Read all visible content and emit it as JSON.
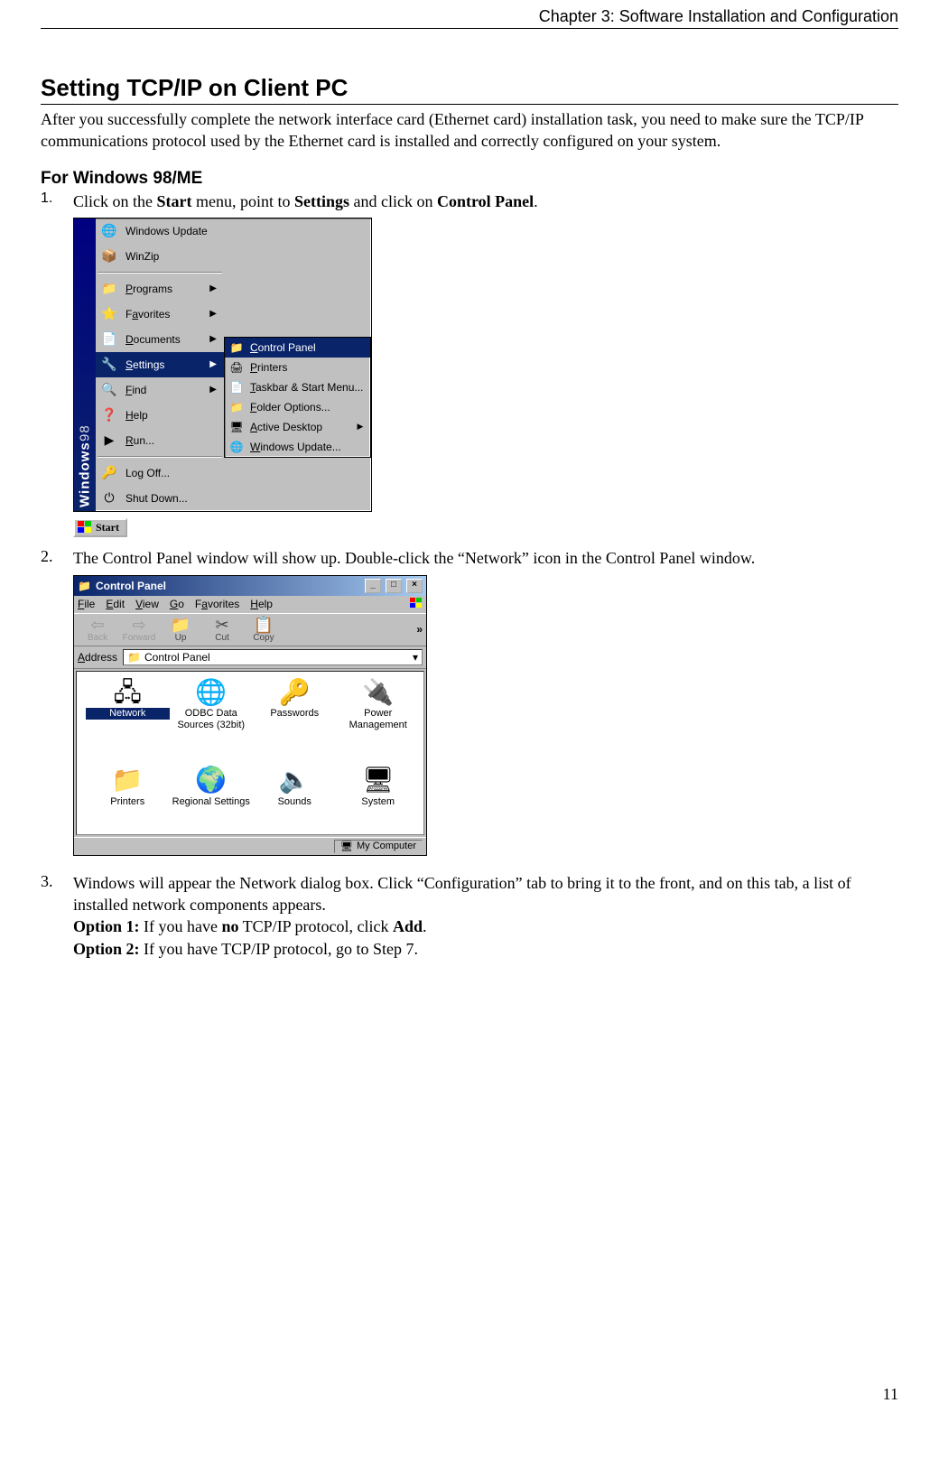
{
  "chapter_header": "Chapter 3: Software Installation and Configuration",
  "section_title": "Setting TCP/IP on Client PC",
  "intro_text": "After you successfully complete the network interface card (Ethernet card) installation task, you need to make sure the TCP/IP communications protocol used by the Ethernet card is installed and correctly configured on your system.",
  "sub_title": "For Windows 98/ME",
  "steps": {
    "s1": {
      "num": "1.",
      "pre": "Click on the ",
      "b1": "Start",
      "mid1": " menu, point to ",
      "b2": "Settings",
      "mid2": " and click on ",
      "b3": "Control Panel",
      "post": "."
    },
    "s2": {
      "num": "2.",
      "text": "The Control Panel window will show up. Double-click the “Network” icon in the Control Panel window."
    },
    "s3": {
      "num": "3.",
      "line1": "Windows will appear the Network dialog box. Click “Configuration” tab to bring it to the front, and on this tab, a list of installed network components appears.",
      "opt1_label": "Option 1:",
      "opt1_a": " If you have ",
      "opt1_b": "no",
      "opt1_c": " TCP/IP protocol, click ",
      "opt1_d": "Add",
      "opt1_e": ".",
      "opt2_label": "Option 2:",
      "opt2_text": " If you have TCP/IP protocol, go to Step 7."
    }
  },
  "start_menu": {
    "strip_a": "Windows",
    "strip_b": "98",
    "items": [
      {
        "label": "Windows Update",
        "icon": "🌐"
      },
      {
        "label": "WinZip",
        "icon": "📦"
      },
      {
        "label": "Programs",
        "icon": "📁",
        "arrow": true,
        "ukey": "P"
      },
      {
        "label": "Favorites",
        "icon": "⭐",
        "arrow": true,
        "ukey": "a"
      },
      {
        "label": "Documents",
        "icon": "📄",
        "arrow": true,
        "ukey": "D"
      },
      {
        "label": "Settings",
        "icon": "🔧",
        "arrow": true,
        "hl": true,
        "ukey": "S"
      },
      {
        "label": "Find",
        "icon": "🔍",
        "arrow": true,
        "ukey": "F"
      },
      {
        "label": "Help",
        "icon": "❓",
        "ukey": "H"
      },
      {
        "label": "Run...",
        "icon": "▶",
        "ukey": "R"
      },
      {
        "label": "Log Off...",
        "icon": "🔑"
      },
      {
        "label": "Shut Down...",
        "icon": "⏻"
      }
    ],
    "submenu": [
      {
        "label": "Control Panel",
        "icon": "📁",
        "hl": true,
        "ukey": "C"
      },
      {
        "label": "Printers",
        "icon": "🖨",
        "ukey": "P"
      },
      {
        "label": "Taskbar & Start Menu...",
        "icon": "📄",
        "ukey": "T"
      },
      {
        "label": "Folder Options...",
        "icon": "📁",
        "ukey": "F"
      },
      {
        "label": "Active Desktop",
        "icon": "🖥",
        "arrow": true,
        "ukey": "A"
      },
      {
        "label": "Windows Update...",
        "icon": "🌐",
        "ukey": "W"
      }
    ],
    "start_button": "Start"
  },
  "control_panel": {
    "title": "Control Panel",
    "menus": [
      {
        "label": "File",
        "u": "F"
      },
      {
        "label": "Edit",
        "u": "E"
      },
      {
        "label": "View",
        "u": "V"
      },
      {
        "label": "Go",
        "u": "G"
      },
      {
        "label": "Favorites",
        "u": "a"
      },
      {
        "label": "Help",
        "u": "H"
      }
    ],
    "toolbar": {
      "back": "Back",
      "forward": "Forward",
      "up": "Up",
      "cut": "Cut",
      "copy": "Copy"
    },
    "address_label": "Address",
    "address_value": "Control Panel",
    "icons": [
      {
        "label": "Network",
        "glyph": "🖧",
        "sel": true
      },
      {
        "label": "ODBC Data Sources (32bit)",
        "glyph": "🌐"
      },
      {
        "label": "Passwords",
        "glyph": "🔑"
      },
      {
        "label": "Power Management",
        "glyph": "🔌"
      },
      {
        "label": "Printers",
        "glyph": "📁"
      },
      {
        "label": "Regional Settings",
        "glyph": "🌍"
      },
      {
        "label": "Sounds",
        "glyph": "🔈"
      },
      {
        "label": "System",
        "glyph": "🖥"
      }
    ],
    "status": "My Computer"
  },
  "page_number": "11"
}
